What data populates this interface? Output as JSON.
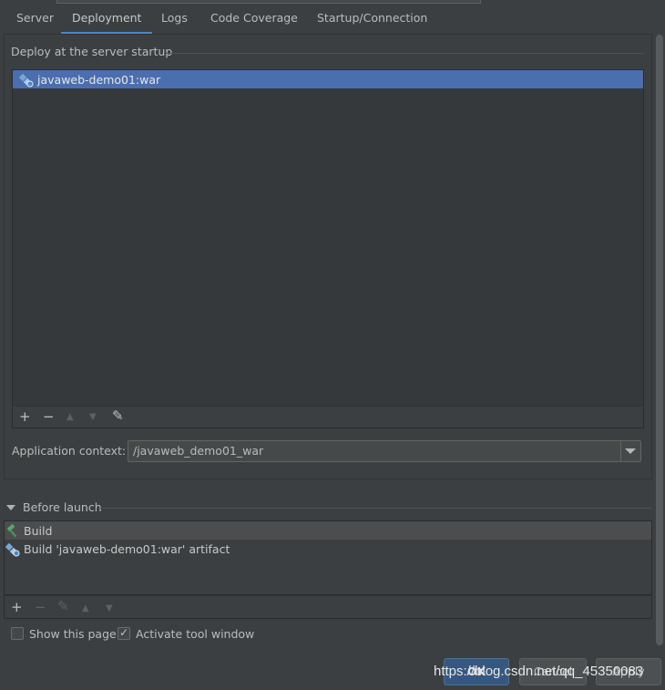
{
  "tabs": [
    {
      "label": "Server"
    },
    {
      "label": "Deployment"
    },
    {
      "label": "Logs"
    },
    {
      "label": "Code Coverage"
    },
    {
      "label": "Startup/Connection"
    }
  ],
  "active_tab": "Deployment",
  "deploy": {
    "title": "Deploy at the server startup",
    "items": [
      {
        "label": "javaweb-demo01:war",
        "icon": "artifact-icon",
        "selected": true
      }
    ],
    "toolbar": {
      "add": "+",
      "remove": "−",
      "up": "▲",
      "down": "▼",
      "edit": "✎"
    }
  },
  "app_context": {
    "label": "Application context:",
    "value": "/javaweb_demo01_war"
  },
  "before_launch": {
    "title": "Before launch",
    "items": [
      {
        "label": "Build",
        "icon": "hammer-icon"
      },
      {
        "label": "Build 'javaweb-demo01:war' artifact",
        "icon": "artifact-icon"
      }
    ],
    "toolbar": {
      "add": "+",
      "remove": "−",
      "edit": "✎",
      "up": "▲",
      "down": "▼"
    }
  },
  "checkboxes": {
    "show_page": {
      "label": "Show this page",
      "checked": false
    },
    "activate_tool": {
      "label": "Activate tool window",
      "checked": true,
      "mark": "✓"
    }
  },
  "buttons": {
    "ok": "OK",
    "cancel": "Cancel",
    "apply": "Apply"
  },
  "watermark": "https://blog.csdn.net/qq_45350083",
  "colors": {
    "background": "#3c3f41",
    "selection": "#4b6eaf",
    "accent": "#4a88c7",
    "ok_button": "#365880"
  }
}
